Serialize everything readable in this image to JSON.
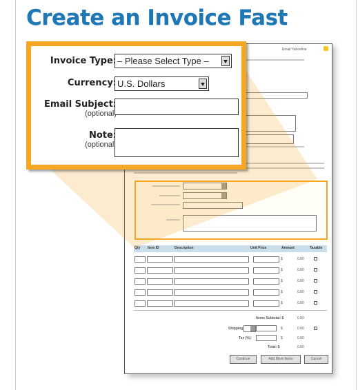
{
  "headline": "Create an Invoice Fast",
  "callout": {
    "invoice_type": {
      "label": "Invoice Type:",
      "value": "– Please Select Type –"
    },
    "currency": {
      "label": "Currency:",
      "value": "U.S. Dollars"
    },
    "email_subject": {
      "label": "Email Subject:",
      "hint": "(optional)",
      "value": ""
    },
    "note": {
      "label": "Note:",
      "hint": "(optional)",
      "value": ""
    }
  },
  "document": {
    "top_link": "Email Yahooline",
    "table_headers": [
      "Qty",
      "Item ID",
      "Description",
      "Unit Price",
      "Amount",
      "Taxable"
    ],
    "table_rows": [
      {
        "currency": "$",
        "amount": "0.00"
      },
      {
        "currency": "$",
        "amount": "0.00"
      },
      {
        "currency": "$",
        "amount": "0.00"
      },
      {
        "currency": "$",
        "amount": "0.00"
      },
      {
        "currency": "$",
        "amount": "0.00"
      }
    ],
    "summary": {
      "items_subtotal": "Items Subtotal: $",
      "items_subtotal_value": "0.00",
      "shipping": "Shipping",
      "shipping_value": "0.00",
      "tax": "Tax (%):",
      "tax_value": "0.00",
      "total": "Total: $",
      "total_value": "0.00"
    },
    "buttons": {
      "continue": "Continue",
      "add_more": "Add More Items",
      "cancel": "Cancel"
    }
  },
  "colors": {
    "headline": "#1f77b4",
    "callout_border": "#f5a623",
    "table_header": "#c9ddea"
  }
}
